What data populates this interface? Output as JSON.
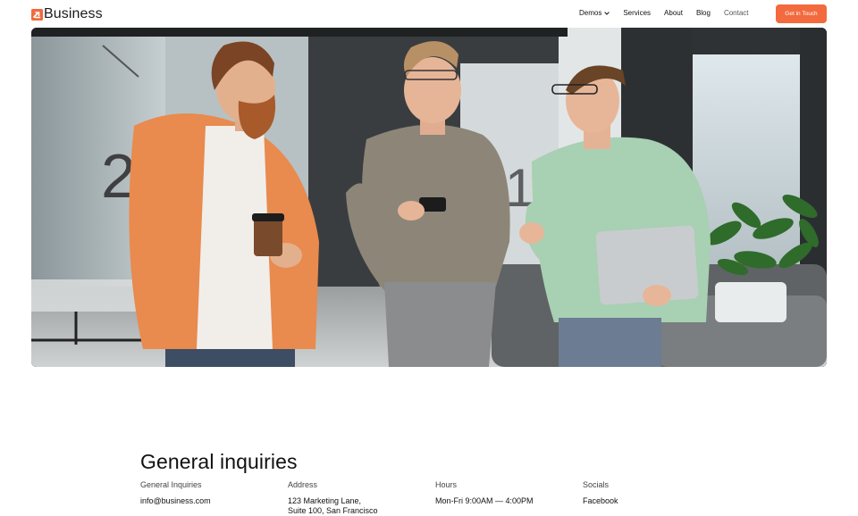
{
  "brand": {
    "name": "Business"
  },
  "nav": {
    "items": [
      {
        "label": "Demos",
        "has_dropdown": true
      },
      {
        "label": "Services"
      },
      {
        "label": "About"
      },
      {
        "label": "Blog"
      },
      {
        "label": "Contact"
      }
    ],
    "cta_label": "Get in Touch"
  },
  "colors": {
    "accent": "#f26a3d"
  },
  "hero": {},
  "inquiries": {
    "title": "General inquiries",
    "columns": [
      {
        "label": "General Inquiries",
        "lines": [
          "info@business.com"
        ]
      },
      {
        "label": "Address",
        "lines": [
          "123 Marketing Lane,",
          "Suite 100, San Francisco"
        ]
      },
      {
        "label": "Hours",
        "lines": [
          "Mon-Fri 9:00AM — 4:00PM"
        ]
      },
      {
        "label": "Socials",
        "lines": [
          "Facebook"
        ]
      }
    ]
  }
}
